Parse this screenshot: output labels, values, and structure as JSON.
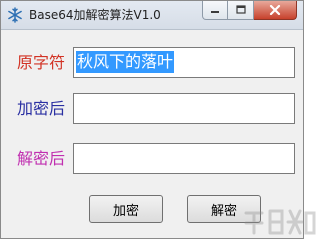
{
  "window": {
    "title": "Base64加解密算法V1.0",
    "icon": "snowflake-icon",
    "controls": [
      "minimize-icon",
      "maximize-icon",
      "close-icon"
    ]
  },
  "fields": {
    "original": {
      "label": "原字符",
      "value": "秋风下的落叶",
      "selected": true
    },
    "encrypted": {
      "label": "加密后",
      "value": ""
    },
    "decrypted": {
      "label": "解密后",
      "value": ""
    }
  },
  "buttons": {
    "encrypt": "加密",
    "decrypt": "解密"
  },
  "colors": {
    "original_label": "#d23224",
    "encrypted_label": "#2a2fa2",
    "decrypted_label": "#c02fb0",
    "selection": "#3399ff"
  }
}
